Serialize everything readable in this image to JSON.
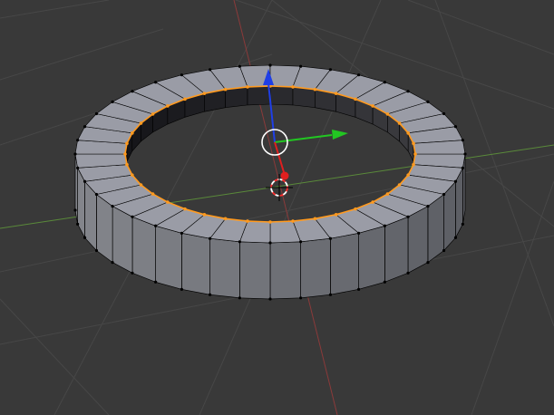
{
  "viewport": {
    "name": "3D Viewport",
    "background_color": "#393939",
    "grid_color": "#474747",
    "x_axis_color": "#8b3a3a",
    "y_axis_color": "#5a8a3a"
  },
  "object": {
    "type": "ring-mesh",
    "segments": 40,
    "mode": "edit",
    "selected_edge_loop": "inner-top",
    "outer_face_color": "#8a8d97",
    "top_face_color": "#9a9ca6",
    "inner_face_color": "#2a2a2e",
    "edge_color": "#000000",
    "selected_edge_color": "#ff9a1f"
  },
  "gizmo": {
    "type": "translate-manipulator",
    "x_color": "#e01f1f",
    "y_color": "#22c622",
    "z_color": "#1f3fe6",
    "center_circle_color": "#ffffff"
  },
  "cursor_3d": {
    "icon": "3d-cursor-icon",
    "primary_color": "#ff2e2e",
    "secondary_color": "#ffffff"
  }
}
